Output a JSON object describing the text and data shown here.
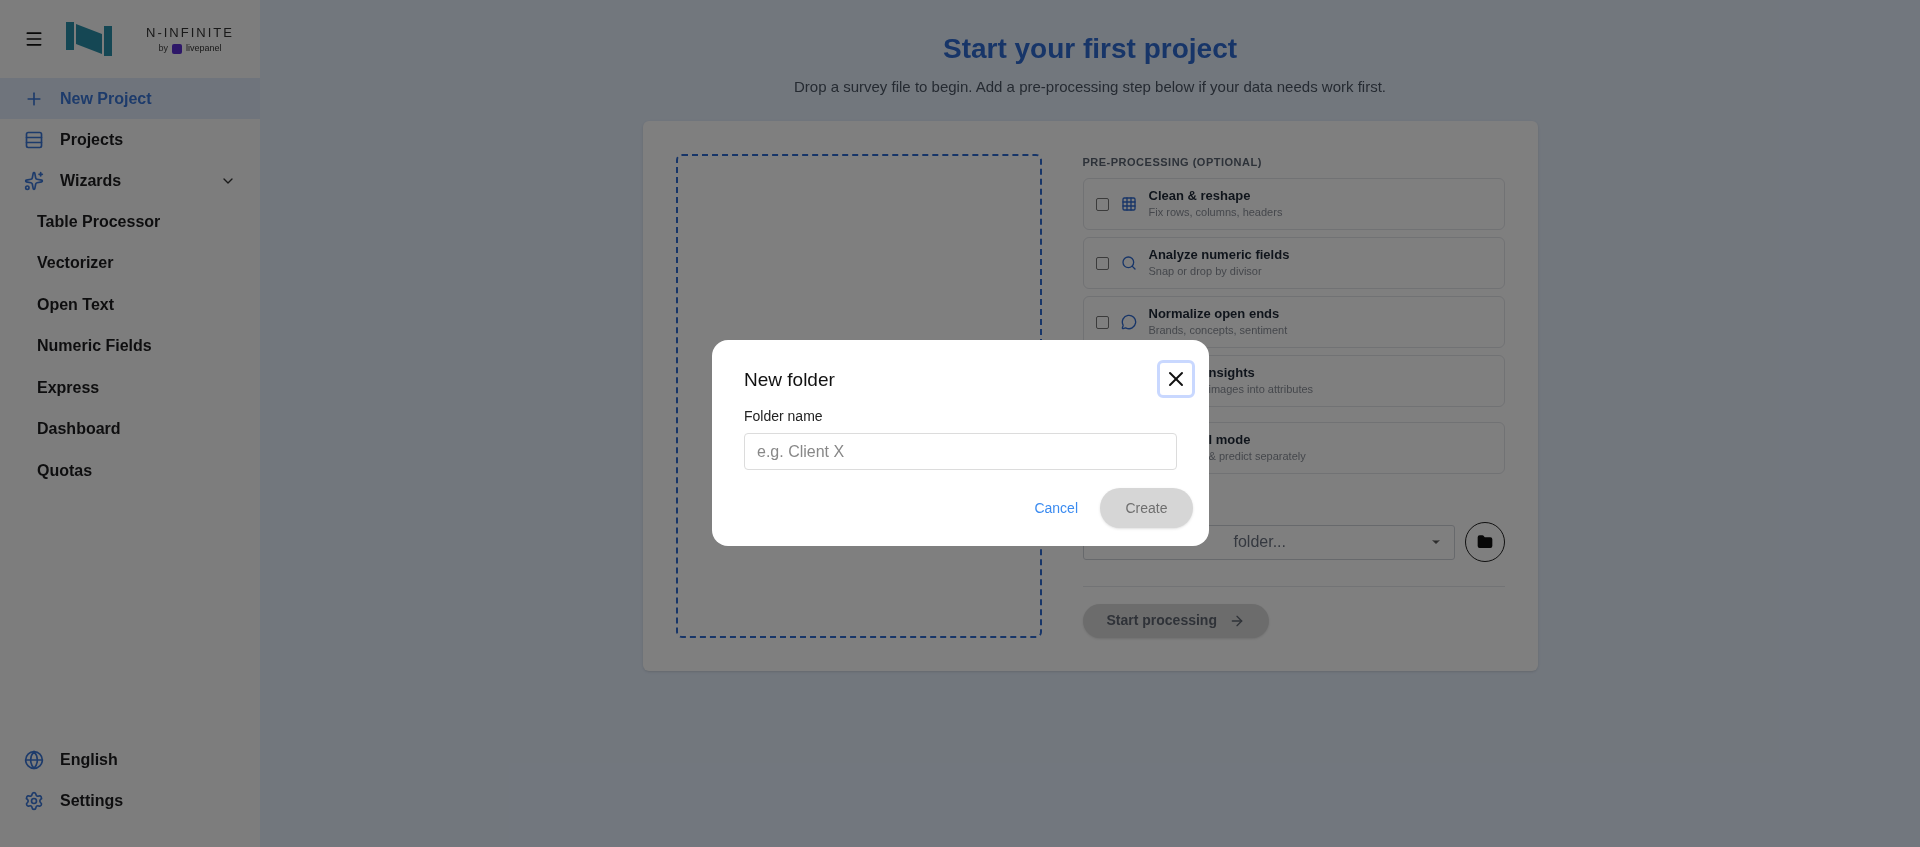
{
  "sidebar": {
    "logo": {
      "name": "N-INFINITE",
      "by": "by",
      "brand": "livepanel"
    },
    "nav": [
      {
        "label": "New Project",
        "selected": true
      },
      {
        "label": "Projects",
        "selected": false
      },
      {
        "label": "Wizards",
        "selected": false,
        "expanded": true,
        "children": [
          {
            "label": "Table Processor",
            "selected": false
          },
          {
            "label": "Vectorizer",
            "selected": false
          },
          {
            "label": "Open Text",
            "selected": false
          },
          {
            "label": "Numeric Fields",
            "selected": false
          },
          {
            "label": "Express",
            "selected": false
          },
          {
            "label": "Dashboard",
            "selected": false
          },
          {
            "label": "Quotas",
            "selected": false
          }
        ]
      }
    ],
    "footer": [
      {
        "label": "English"
      },
      {
        "label": "Settings"
      }
    ]
  },
  "main": {
    "title": "Start your first project",
    "subtitle": "Drop a survey file to begin. Add a pre-processing step below if your data needs work first.",
    "preprocessing": {
      "heading": "PRE-PROCESSING (OPTIONAL)",
      "options": [
        {
          "kind": "option",
          "title": "Clean & reshape",
          "subtitle": "Fix rows, columns, headers",
          "checked": false
        },
        {
          "kind": "option",
          "title": "Analyze numeric fields",
          "subtitle": "Snap or drop by divisor",
          "checked": false
        },
        {
          "kind": "option",
          "title": "Normalize open ends",
          "subtitle": "Brands, concepts, sentiment",
          "checked": false
        },
        {
          "kind": "covered",
          "title": "nsights",
          "subtitle": "images into attributes"
        },
        {
          "kind": "covered",
          "title": "l mode",
          "subtitle": "& predict separately"
        }
      ]
    },
    "folder_select": {
      "placeholder": "folder..."
    },
    "start_button": {
      "label": "Start processing",
      "disabled": true
    }
  },
  "dialog": {
    "title": "New folder",
    "field": {
      "label": "Folder name",
      "placeholder": "e.g. Client X"
    },
    "cancel": "Cancel",
    "create": {
      "label": "Create",
      "disabled": true
    }
  }
}
